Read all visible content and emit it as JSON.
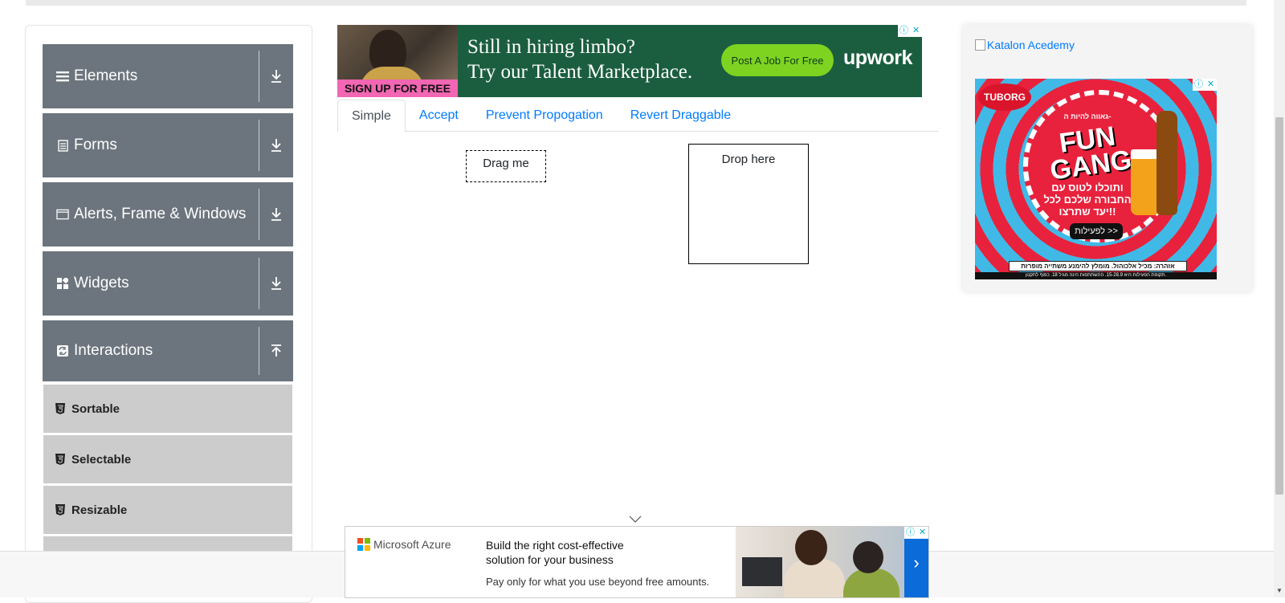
{
  "sidebar": {
    "groups": [
      {
        "label": "Elements",
        "icon": "list-icon",
        "arrow": "download-arrow-icon"
      },
      {
        "label": "Forms",
        "icon": "document-icon",
        "arrow": "download-arrow-icon"
      },
      {
        "label": "Alerts, Frame & Windows",
        "icon": "window-icon",
        "arrow": "download-arrow-icon"
      },
      {
        "label": "Widgets",
        "icon": "widgets-icon",
        "arrow": "download-arrow-icon"
      },
      {
        "label": "Interactions",
        "icon": "interactions-icon",
        "arrow": "upload-arrow-icon"
      }
    ],
    "subitems": [
      {
        "label": "Sortable"
      },
      {
        "label": "Selectable"
      },
      {
        "label": "Resizable"
      }
    ]
  },
  "ad_top": {
    "signup": "SIGN UP FOR FREE",
    "headline_1": "Still in hiring limbo?",
    "headline_2": "Try our Talent Marketplace.",
    "cta": "Post A Job For Free",
    "brand": "upwork"
  },
  "tabs": [
    {
      "label": "Simple",
      "active": true
    },
    {
      "label": "Accept"
    },
    {
      "label": "Prevent Propogation"
    },
    {
      "label": "Revert Draggable"
    }
  ],
  "draggable": {
    "label": "Drag me"
  },
  "droppable": {
    "label": "Drop here"
  },
  "right_ad": {
    "broken_image_alt": "Katalon Acedemy",
    "tuborg": {
      "brand": "TUBORG",
      "heading_small": "גאווה להיות ה-",
      "headline": "FUN GANG",
      "body": "ותוכלו לטוס עם החבורה שלכם לכל יעד שתרצו!!",
      "button": "לפעילות >>",
      "warning": "אזהרה: מכיל אלכוהול. מומלץ להימנע משתייה מופרזת",
      "fineprint": "תקופת הפעילות היא 15-28.9. ההשתתפות הינה מגיל 18. כפוף לתקנון."
    }
  },
  "ad_bottom": {
    "brand": "Microsoft Azure",
    "headline": "Build the right cost-effective solution for your business",
    "subline": "Pay only for what you use beyond free amounts.",
    "next": "›"
  },
  "ad_controls": {
    "info": "ⓘ",
    "close": "✕"
  },
  "colors": {
    "sidebar_group": "#6c757d",
    "sidebar_sub": "#cccccc",
    "link": "#007bff",
    "upwork_green": "#1b5e3f",
    "azure_blue": "#0b6bd9"
  }
}
